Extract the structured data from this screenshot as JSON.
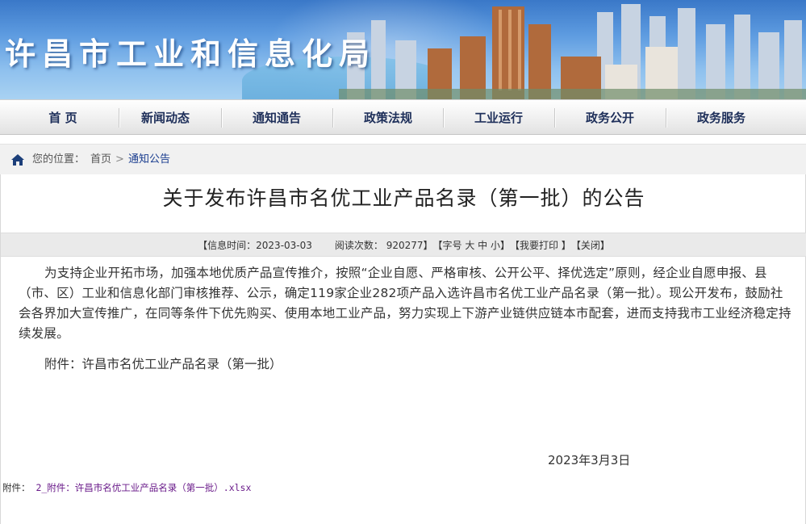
{
  "banner": {
    "title": "许昌市工业和信息化局"
  },
  "nav": {
    "items": [
      {
        "label": "首 页"
      },
      {
        "label": "新闻动态"
      },
      {
        "label": "通知通告"
      },
      {
        "label": "政策法规"
      },
      {
        "label": "工业运行"
      },
      {
        "label": "政务公开"
      },
      {
        "label": "政务服务"
      }
    ]
  },
  "breadcrumb": {
    "label": "您的位置：",
    "home": "首页",
    "separator": ">",
    "current": "通知公告"
  },
  "article": {
    "title": "关于发布许昌市名优工业产品名录（第一批）的公告",
    "meta": {
      "time": "【信息时间：2023-03-03",
      "views": "阅读次数：  920277】",
      "font_size": "【字号 大 中 小】",
      "print": "【我要打印 】",
      "close": "【关闭】"
    },
    "body": "为支持企业开拓市场，加强本地优质产品宣传推介，按照“企业自愿、严格审核、公开公平、择优选定”原则，经企业自愿申报、县（市、区）工业和信息化部门审核推荐、公示，确定119家企业282项产品入选许昌市名优工业产品名录（第一批）。现公开发布，鼓励社会各界加大宣传推广，在同等条件下优先购买、使用本地工业产品，努力实现上下游产业链供应链本市配套，进而支持我市工业经济稳定持续发展。",
    "attachment_line": "附件：许昌市名优工业产品名录（第一批）",
    "date": "2023年3月3日",
    "file_label": "附件：",
    "file_link": "2_附件：许昌市名优工业产品名录（第一批）.xlsx"
  },
  "colors": {
    "nav_text": "#1e2f5a",
    "breadcrumb_current": "#1a3d8f",
    "file_link": "#6a1b8a"
  }
}
